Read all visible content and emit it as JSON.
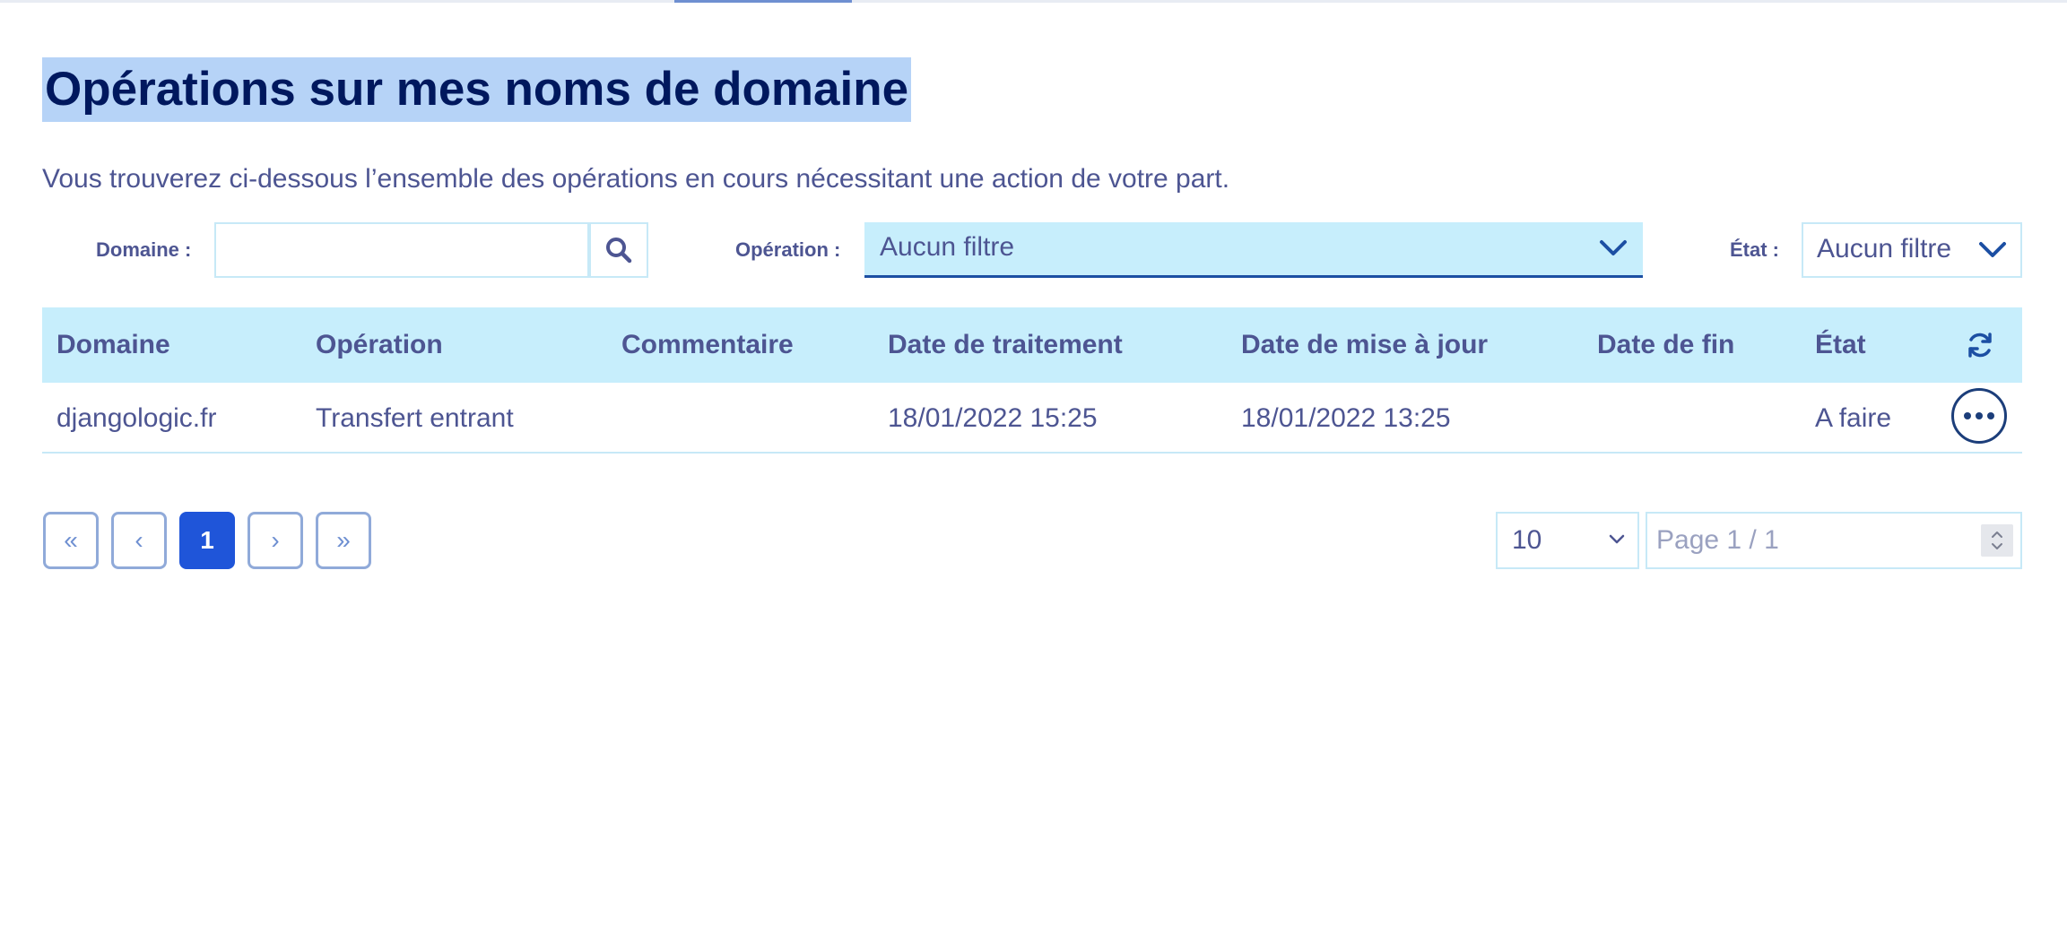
{
  "page": {
    "title": "Opérations sur mes noms de domaine",
    "subtitle": "Vous trouverez ci-dessous l’ensemble des opérations en cours nécessitant une action de votre part."
  },
  "filters": {
    "domain_label": "Domaine :",
    "domain_value": "",
    "search_icon": "search-icon",
    "operation_label": "Opération :",
    "operation_value": "Aucun filtre",
    "state_label": "État :",
    "state_value": "Aucun filtre"
  },
  "table": {
    "columns": [
      "Domaine",
      "Opération",
      "Commentaire",
      "Date de traitement",
      "Date de mise à jour",
      "Date de fin",
      "État"
    ],
    "refresh_icon": "refresh-icon",
    "rows": [
      {
        "domain": "djangologic.fr",
        "operation": "Transfert entrant",
        "comment": "",
        "processing_date": "18/01/2022 15:25",
        "update_date": "18/01/2022 13:25",
        "end_date": "",
        "state": "A faire",
        "actions_icon": "more-icon"
      }
    ]
  },
  "pagination": {
    "first": "«",
    "prev": "‹",
    "current": "1",
    "next": "›",
    "last": "»",
    "page_size": "10",
    "page_placeholder": "Page 1 / 1"
  },
  "colors": {
    "title_highlight": "#b6d3f7",
    "header_bg": "#c7eefc",
    "accent": "#1f55d9",
    "text": "#4d5592"
  }
}
